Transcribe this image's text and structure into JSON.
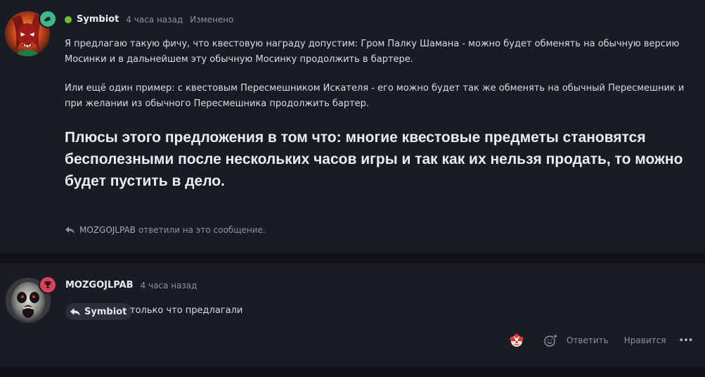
{
  "post1": {
    "author": "Symbiot",
    "time": "4 часа назад",
    "edited": "Изменено",
    "paragraphs": [
      "Я предлагаю такую фичу, что квестовую награду допустим: Гром Палку Шамана - можно будет обменять на обычную версию Мосинки и в дальнейшем эту обычную Мосинку продолжить в бартере.",
      "Или ещё один пример: с квестовым Пересмешником Искателя - его можно будет так же обменять на обычный Пересмешник и при желании из обычного Пересмешника продолжить бартер."
    ],
    "highlight": "Плюсы этого предложения в том что: многие квестовые предметы становятся бесполезными после нескольких часов игры и так как их нельзя продать, то можно будет пустить в дело.",
    "replied_by": "MOZGOJLPAB",
    "replied_suffix": "ответили на это сообщение."
  },
  "post2": {
    "author": "MOZGOJLPAB",
    "time": "4 часа назад",
    "mention": "Symbiot",
    "text": "только что предлагали",
    "actions": {
      "reply_label": "Ответить",
      "like_label": "Нравится",
      "more_label": "•••"
    }
  },
  "colors": {
    "background": "#191b25",
    "separator": "#111218",
    "online": "#6fbf2a",
    "badge_green": "#3fb98a",
    "badge_red": "#d8435a"
  },
  "icons": [
    "reply-arrow-icon",
    "clown-reaction-icon",
    "add-reaction-icon",
    "more-options-icon",
    "trophy-badge-icon",
    "rank-badge-icon"
  ]
}
